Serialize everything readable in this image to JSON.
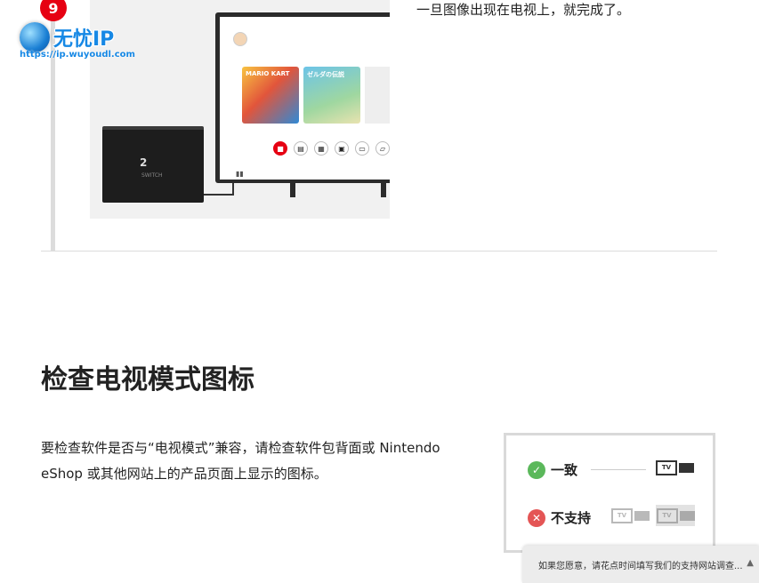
{
  "step": {
    "number": "9",
    "text": "一旦图像出现在电视上，就完成了。"
  },
  "illustration": {
    "tiles": [
      {
        "label": "MARIO KART"
      },
      {
        "label": "ゼルダの伝説"
      }
    ],
    "dock_logo": "2",
    "dock_sub": "SWITCH"
  },
  "watermark": {
    "name": "无忧IP",
    "url": "https://ip.wuyoudl.com"
  },
  "section": {
    "heading": "检查电视模式图标",
    "body": "要检查软件是否与“电视模式”兼容，请检查软件包背面或 Nintendo eShop 或其他网站上的产品页面上显示的图标。"
  },
  "icon_box": {
    "supported_label": "一致",
    "unsupported_label": "不支持",
    "tv_icon_text": "TV"
  },
  "survey": {
    "text": "如果您愿意，请花点时间填写我们的支持网站调查...",
    "arrow": "▲"
  }
}
